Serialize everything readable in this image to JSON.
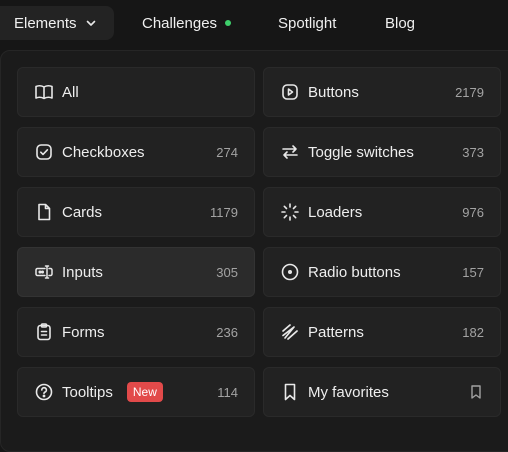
{
  "nav": {
    "elements_label": "Elements",
    "challenges_label": "Challenges",
    "challenges_dot_color": "#3ecf6b",
    "spotlight_label": "Spotlight",
    "blog_label": "Blog"
  },
  "menu": {
    "items": [
      {
        "label": "All",
        "count": "",
        "icon": "book-open-icon"
      },
      {
        "label": "Buttons",
        "count": "2179",
        "icon": "button-icon"
      },
      {
        "label": "Checkboxes",
        "count": "274",
        "icon": "checkbox-icon"
      },
      {
        "label": "Toggle switches",
        "count": "373",
        "icon": "toggle-arrows-icon"
      },
      {
        "label": "Cards",
        "count": "1179",
        "icon": "card-file-icon"
      },
      {
        "label": "Loaders",
        "count": "976",
        "icon": "loader-spinner-icon"
      },
      {
        "label": "Inputs",
        "count": "305",
        "icon": "input-cursor-icon"
      },
      {
        "label": "Radio buttons",
        "count": "157",
        "icon": "radio-icon"
      },
      {
        "label": "Forms",
        "count": "236",
        "icon": "clipboard-form-icon"
      },
      {
        "label": "Patterns",
        "count": "182",
        "icon": "pattern-waves-icon"
      },
      {
        "label": "Tooltips",
        "count": "114",
        "icon": "help-circle-icon",
        "badge": "New"
      },
      {
        "label": "My favorites",
        "count": "",
        "icon": "bookmark-icon"
      }
    ],
    "badge_color": "#e24a4a"
  }
}
